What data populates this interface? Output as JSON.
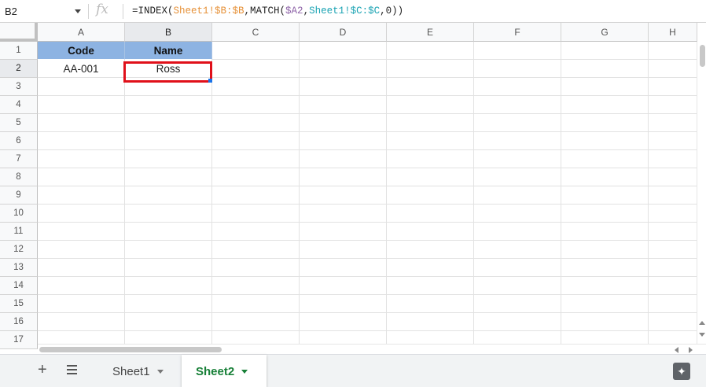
{
  "formula_bar": {
    "name_box": "B2",
    "fx_label": "fx",
    "formula_parts": [
      {
        "text": "=INDEX(",
        "cls": ""
      },
      {
        "text": "Sheet1!$B:$B",
        "cls": "ref-a"
      },
      {
        "text": ",MATCH(",
        "cls": ""
      },
      {
        "text": "$A2",
        "cls": "ref-b"
      },
      {
        "text": ",",
        "cls": ""
      },
      {
        "text": "Sheet1!$C:$C",
        "cls": "ref-c"
      },
      {
        "text": ",0))",
        "cls": ""
      }
    ]
  },
  "columns": [
    "A",
    "B",
    "C",
    "D",
    "E",
    "F",
    "G",
    "H"
  ],
  "rows": [
    "1",
    "2",
    "3",
    "4",
    "5",
    "6",
    "7",
    "8",
    "9",
    "10",
    "11",
    "12",
    "13",
    "14",
    "15",
    "16",
    "17"
  ],
  "active_cell": {
    "col": "B",
    "row": "2"
  },
  "cells": {
    "A1": "Code",
    "B1": "Name",
    "A2": "AA-001",
    "B2": "Ross"
  },
  "header_fill": "#8db3e2",
  "selection_color": "#e0101a",
  "sheet_tabs": [
    {
      "label": "Sheet1",
      "active": false
    },
    {
      "label": "Sheet2",
      "active": true
    }
  ],
  "icons": {
    "add_sheet": "plus-icon",
    "all_sheets": "menu-lines-icon",
    "explore": "sparkle-icon"
  }
}
